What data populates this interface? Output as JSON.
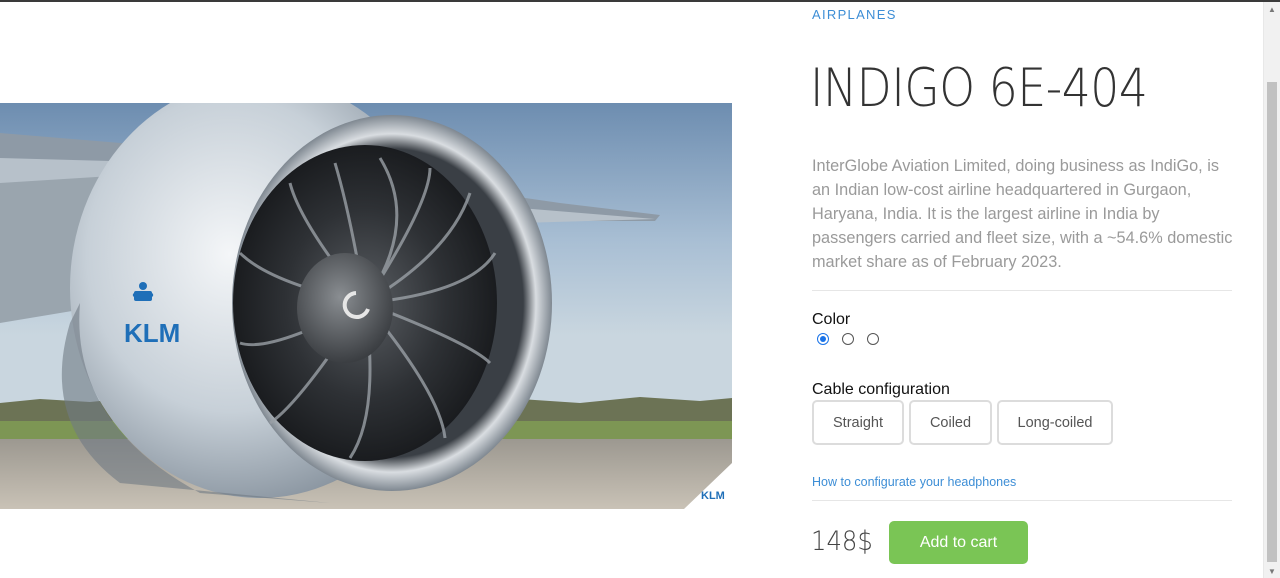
{
  "category": "AIRPLANES",
  "product": {
    "title": "INDIGO 6E-404",
    "description": "InterGlobe Aviation Limited, doing business as IndiGo, is an Indian low-cost airline headquartered in Gurgaon, Haryana, India. It is the largest airline in India by passengers carried and fleet size, with a ~54.6% domestic market share as of February 2023.",
    "image_logo_text": "KLM",
    "image_badge_text": "KLM"
  },
  "color": {
    "label": "Color",
    "options": [
      {
        "selected": true,
        "hex": "#1a73e8"
      },
      {
        "selected": false
      },
      {
        "selected": false
      }
    ]
  },
  "cable": {
    "label": "Cable configuration",
    "options": [
      "Straight",
      "Coiled",
      "Long-coiled"
    ]
  },
  "config_link": "How to configurate your headphones",
  "price": "148$",
  "add_to_cart_label": "Add to cart",
  "colors": {
    "accent_link": "#3d8ed6",
    "cart_button": "#7ac555",
    "klm_blue": "#1f6fb8"
  }
}
